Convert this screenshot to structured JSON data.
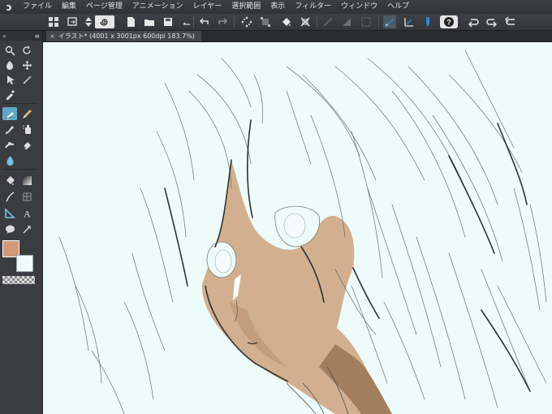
{
  "app": {
    "logo": "ↄ"
  },
  "menu": [
    "ファイル",
    "編集",
    "ページ管理",
    "アニメーション",
    "レイヤー",
    "選択範囲",
    "表示",
    "フィルター",
    "ウィンドウ",
    "ヘルプ"
  ],
  "panel": {
    "collapse_glyph": "«",
    "menu_glyph": "≡"
  },
  "canvas_tab": {
    "title": "イラスト* (4001 x 3001px 600dpi 183.7%)",
    "close": "×"
  },
  "colors": {
    "main": "#d09a76",
    "sub": "#f0fbfa",
    "canvas": "#eefcf9",
    "accent": "#5fa9c8"
  },
  "toolbar_icons": [
    "grid-icon",
    "import-icon",
    "up-down-icon",
    "spiral-icon",
    "new-file-icon",
    "open-folder-icon",
    "save-icon",
    "undo-icon",
    "redo-icon",
    "scatter-icon",
    "transform-icon",
    "fill-icon",
    "crop-icon",
    "clear-icon",
    "layer-mask-icon",
    "select-all-icon",
    "pen-select-icon",
    "ruler-icon",
    "ink-icon",
    "help-icon",
    "rotate-left-icon",
    "rotate-right-icon",
    "reset-icon"
  ],
  "tools": [
    "zoom",
    "rotate",
    "move-layer",
    "move",
    "object-select",
    "eyedropper",
    "pen-active",
    "pencil",
    "brush",
    "airbrush",
    "decoration",
    "eraser",
    "blend",
    "fill",
    "gradient",
    "figure",
    "frame",
    "ruler",
    "text",
    "balloon",
    "correction"
  ]
}
